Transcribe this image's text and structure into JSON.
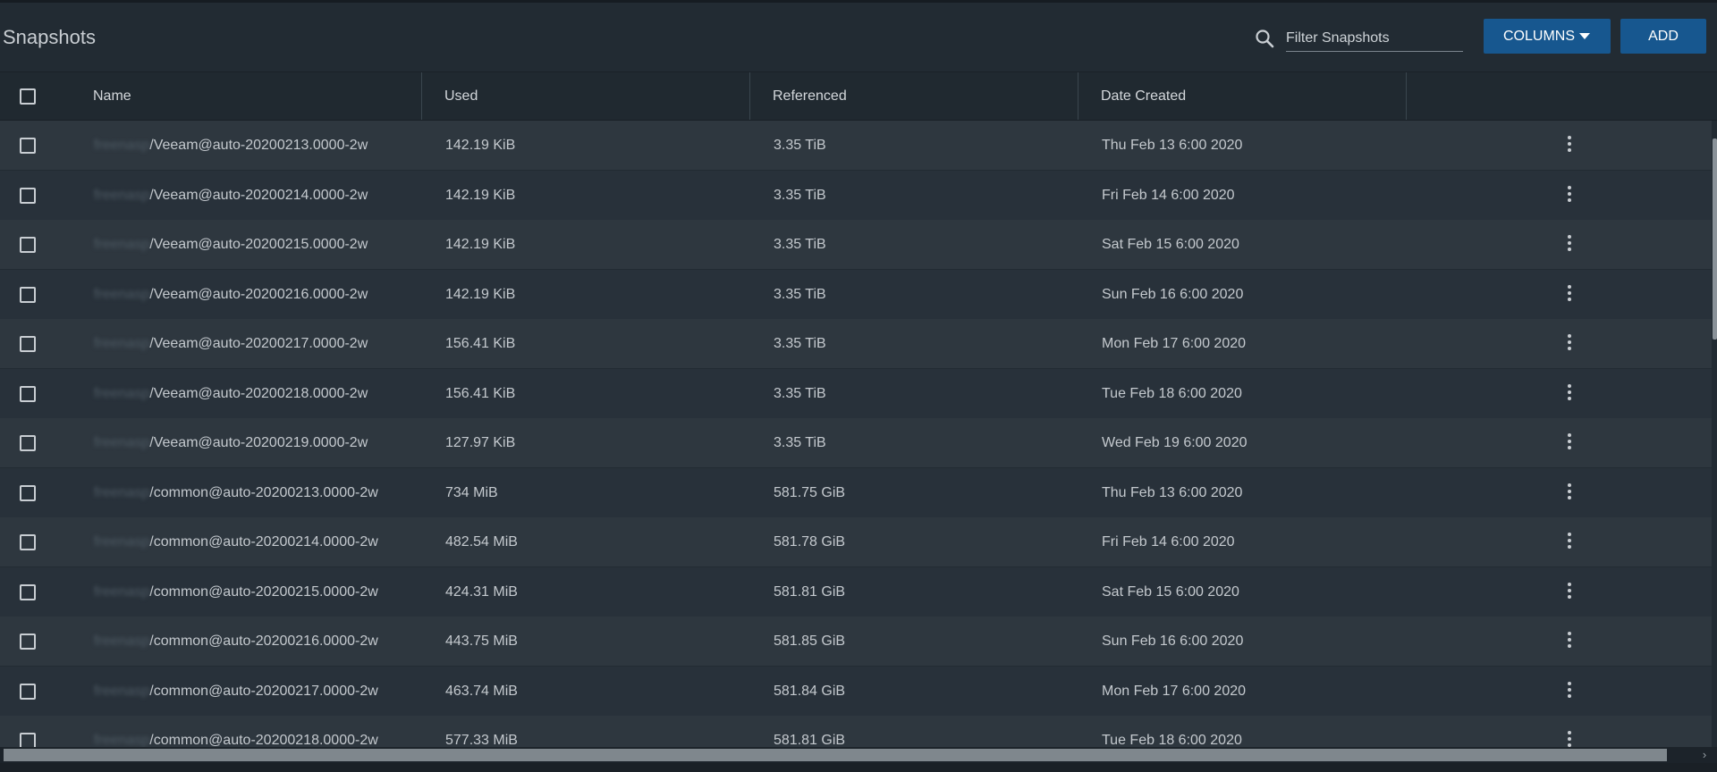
{
  "header": {
    "title": "Snapshots",
    "filter_placeholder": "Filter Snapshots",
    "columns_label": "COLUMNS",
    "add_label": "ADD"
  },
  "columns": {
    "name": "Name",
    "used": "Used",
    "referenced": "Referenced",
    "date_created": "Date Created"
  },
  "rows": [
    {
      "pool": "freenasp",
      "path": "/Veeam@auto-20200213.0000-2w",
      "used": "142.19 KiB",
      "referenced": "3.35 TiB",
      "date": "Thu Feb 13 6:00 2020"
    },
    {
      "pool": "freenasp",
      "path": "/Veeam@auto-20200214.0000-2w",
      "used": "142.19 KiB",
      "referenced": "3.35 TiB",
      "date": "Fri Feb 14 6:00 2020"
    },
    {
      "pool": "freenasp",
      "path": "/Veeam@auto-20200215.0000-2w",
      "used": "142.19 KiB",
      "referenced": "3.35 TiB",
      "date": "Sat Feb 15 6:00 2020"
    },
    {
      "pool": "freenasp",
      "path": "/Veeam@auto-20200216.0000-2w",
      "used": "142.19 KiB",
      "referenced": "3.35 TiB",
      "date": "Sun Feb 16 6:00 2020"
    },
    {
      "pool": "freenasp",
      "path": "/Veeam@auto-20200217.0000-2w",
      "used": "156.41 KiB",
      "referenced": "3.35 TiB",
      "date": "Mon Feb 17 6:00 2020"
    },
    {
      "pool": "freenasp",
      "path": "/Veeam@auto-20200218.0000-2w",
      "used": "156.41 KiB",
      "referenced": "3.35 TiB",
      "date": "Tue Feb 18 6:00 2020"
    },
    {
      "pool": "freenasp",
      "path": "/Veeam@auto-20200219.0000-2w",
      "used": "127.97 KiB",
      "referenced": "3.35 TiB",
      "date": "Wed Feb 19 6:00 2020"
    },
    {
      "pool": "freenasp",
      "path": "/common@auto-20200213.0000-2w",
      "used": "734 MiB",
      "referenced": "581.75 GiB",
      "date": "Thu Feb 13 6:00 2020"
    },
    {
      "pool": "freenasp",
      "path": "/common@auto-20200214.0000-2w",
      "used": "482.54 MiB",
      "referenced": "581.78 GiB",
      "date": "Fri Feb 14 6:00 2020"
    },
    {
      "pool": "freenasp",
      "path": "/common@auto-20200215.0000-2w",
      "used": "424.31 MiB",
      "referenced": "581.81 GiB",
      "date": "Sat Feb 15 6:00 2020"
    },
    {
      "pool": "freenasp",
      "path": "/common@auto-20200216.0000-2w",
      "used": "443.75 MiB",
      "referenced": "581.85 GiB",
      "date": "Sun Feb 16 6:00 2020"
    },
    {
      "pool": "freenasp",
      "path": "/common@auto-20200217.0000-2w",
      "used": "463.74 MiB",
      "referenced": "581.84 GiB",
      "date": "Mon Feb 17 6:00 2020"
    },
    {
      "pool": "freenasp",
      "path": "/common@auto-20200218.0000-2w",
      "used": "577.33 MiB",
      "referenced": "581.81 GiB",
      "date": "Tue Feb 18 6:00 2020"
    }
  ],
  "colors": {
    "accent": "#17578f",
    "background": "#222b33",
    "row_odd": "#2e373f",
    "row_even": "#28313a"
  },
  "icons": {
    "search": "search-icon",
    "columns_dropdown": "caret-down-icon",
    "row_menu": "kebab-menu-icon",
    "scroll_right": "chevron-right-icon"
  }
}
